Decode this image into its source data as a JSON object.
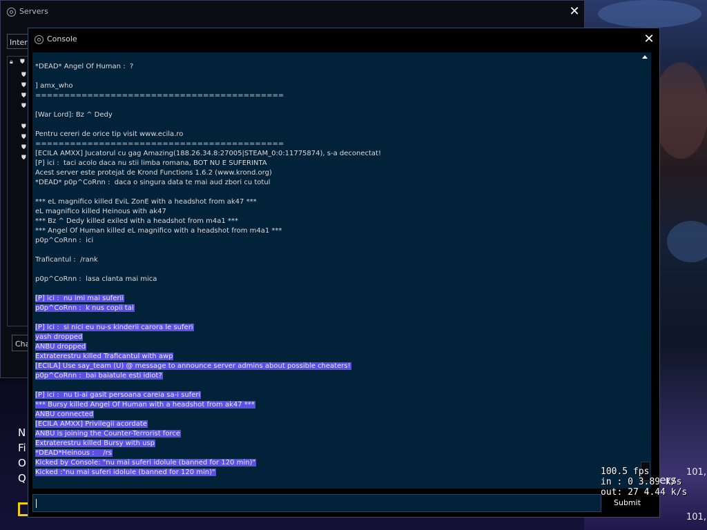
{
  "servers_window": {
    "title": "Servers",
    "tab_label": "Intern",
    "change_button": "Cha"
  },
  "console": {
    "title": "Console",
    "lines": [
      {
        "text": "*DEAD* Angel Of Human :  ?",
        "selected": false
      },
      {
        "text": "",
        "selected": false
      },
      {
        "text": "] amx_who",
        "selected": false
      },
      {
        "text": "===========================================",
        "selected": false
      },
      {
        "text": "",
        "selected": false
      },
      {
        "text": "[War Lord]: Bz ^ Dedy",
        "selected": false
      },
      {
        "text": "",
        "selected": false
      },
      {
        "text": "Pentru cereri de orice tip visit www.ecila.ro",
        "selected": false
      },
      {
        "text": "===========================================",
        "selected": false
      },
      {
        "text": "[ECILA AMXX] Jucatorul cu gag Amazing(188.26.34.8:27005|STEAM_0:0:11775874), s-a deconectat!",
        "selected": false
      },
      {
        "text": "[P] ici :  taci acolo daca nu stii limba romana, BOT NU E SUFERINTA",
        "selected": false
      },
      {
        "text": "Acest server este protejat de Krond Functions 1.6.2 (www.krond.org)",
        "selected": false
      },
      {
        "text": "*DEAD* p0p^CoRnn :  daca o singura data te mai aud zbori cu totul",
        "selected": false
      },
      {
        "text": "",
        "selected": false
      },
      {
        "text": "*** eL magnifico killed EviL ZonE with a headshot from ak47 ***",
        "selected": false
      },
      {
        "text": "eL magnifico killed Heinous with ak47",
        "selected": false
      },
      {
        "text": "*** Bz ^ Dedy killed exiled with a headshot from m4a1 ***",
        "selected": false
      },
      {
        "text": "*** Angel Of Human killed eL magnifico with a headshot from m4a1 ***",
        "selected": false
      },
      {
        "text": "p0p^CoRnn :  ici",
        "selected": false
      },
      {
        "text": "",
        "selected": false
      },
      {
        "text": "Traficantul :  /rank",
        "selected": false
      },
      {
        "text": "",
        "selected": false
      },
      {
        "text": "p0p^CoRnn :  lasa clanta mai mica",
        "selected": false
      },
      {
        "text": "",
        "selected": false
      },
      {
        "text": "[P] ici :  nu imi mai suferii",
        "selected": true
      },
      {
        "text": "p0p^CoRnn :  k nus copii tai",
        "selected": true
      },
      {
        "text": "",
        "selected": false
      },
      {
        "text": "[P] ici :  si nici eu nu-s kinderii carora le suferi",
        "selected": true
      },
      {
        "text": "yash dropped",
        "selected": true
      },
      {
        "text": "ANBU dropped",
        "selected": true
      },
      {
        "text": "Extraterestru killed Traficantul with awp",
        "selected": true
      },
      {
        "text": "[ECILA] Use say_team (U) @ message to announce server admins about possible cheaters!",
        "selected": true
      },
      {
        "text": "p0p^CoRnn :  bai baiatule esti idiot?",
        "selected": true
      },
      {
        "text": "",
        "selected": false
      },
      {
        "text": "[P] ici :  nu ti-ai gasit persoana careia sa-i suferi",
        "selected": true
      },
      {
        "text": "*** Bursy killed Angel Of Human with a headshot from ak47 ***",
        "selected": true
      },
      {
        "text": "ANBU connected",
        "selected": true
      },
      {
        "text": "[ECILA AMXX] Privilegii acordate",
        "selected": true
      },
      {
        "text": "ANBU is joining the Counter-Terrorist force",
        "selected": true
      },
      {
        "text": "Extraterestru killed Bursy with usp",
        "selected": true
      },
      {
        "text": "*DEAD*Heinous :    /rs",
        "selected": true
      },
      {
        "text": "Kicked by Console: \"nu mai suferi idolule (banned for 120 min)\"",
        "selected": true
      },
      {
        "text": "Kicked :\"nu mai suferi idolule (banned for 120 min)\"",
        "selected": true
      }
    ],
    "input_value": "",
    "submit_label": "Submit"
  },
  "netgraph": {
    "fps": "100.5 fps",
    "in": "in :  0 3.89 k/s",
    "out": "out:  27 4.44 k/s"
  },
  "background_menu": {
    "items": [
      "N",
      "Fi",
      "O",
      "Q"
    ]
  },
  "background_overlay": {
    "ers": "ers",
    "num1": "101,",
    "num2": "101,"
  },
  "colors": {
    "console_bg": "#022239",
    "selection": "#5c4fe6"
  }
}
